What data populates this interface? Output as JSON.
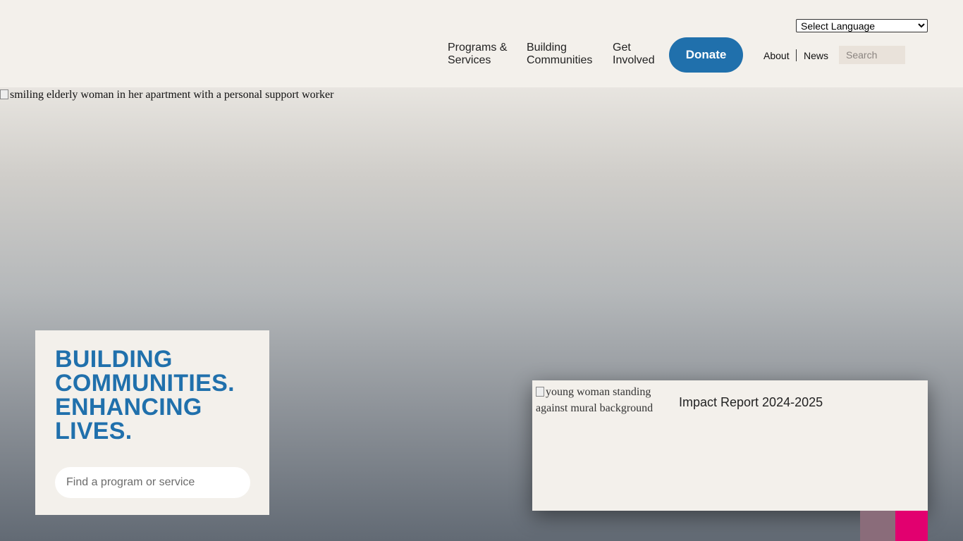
{
  "header": {
    "language_select": {
      "selected": "Select Language",
      "options": [
        "Select Language"
      ]
    },
    "nav": {
      "programs": [
        "Programs &",
        "Services"
      ],
      "building": [
        "Building",
        "Communities"
      ],
      "involved": [
        "Get",
        "Involved"
      ]
    },
    "donate_label": "Donate",
    "utility": {
      "about": "About",
      "news": "News"
    },
    "search_placeholder": "Search"
  },
  "hero": {
    "image_alt": "smiling elderly woman in her apartment with a personal support worker",
    "title_lines": [
      "BUILDING",
      "COMMUNITIES.",
      "ENHANCING",
      "LIVES."
    ],
    "search_placeholder": "Find a program or service"
  },
  "impact": {
    "image_alt": "young woman standing against mural background",
    "title": "Impact Report 2024-2025"
  },
  "colors": {
    "brand_blue": "#2070ac",
    "background": "#f3f0eb",
    "accent_pink": "#e2006f",
    "accent_mauve": "#8a6c7a"
  }
}
